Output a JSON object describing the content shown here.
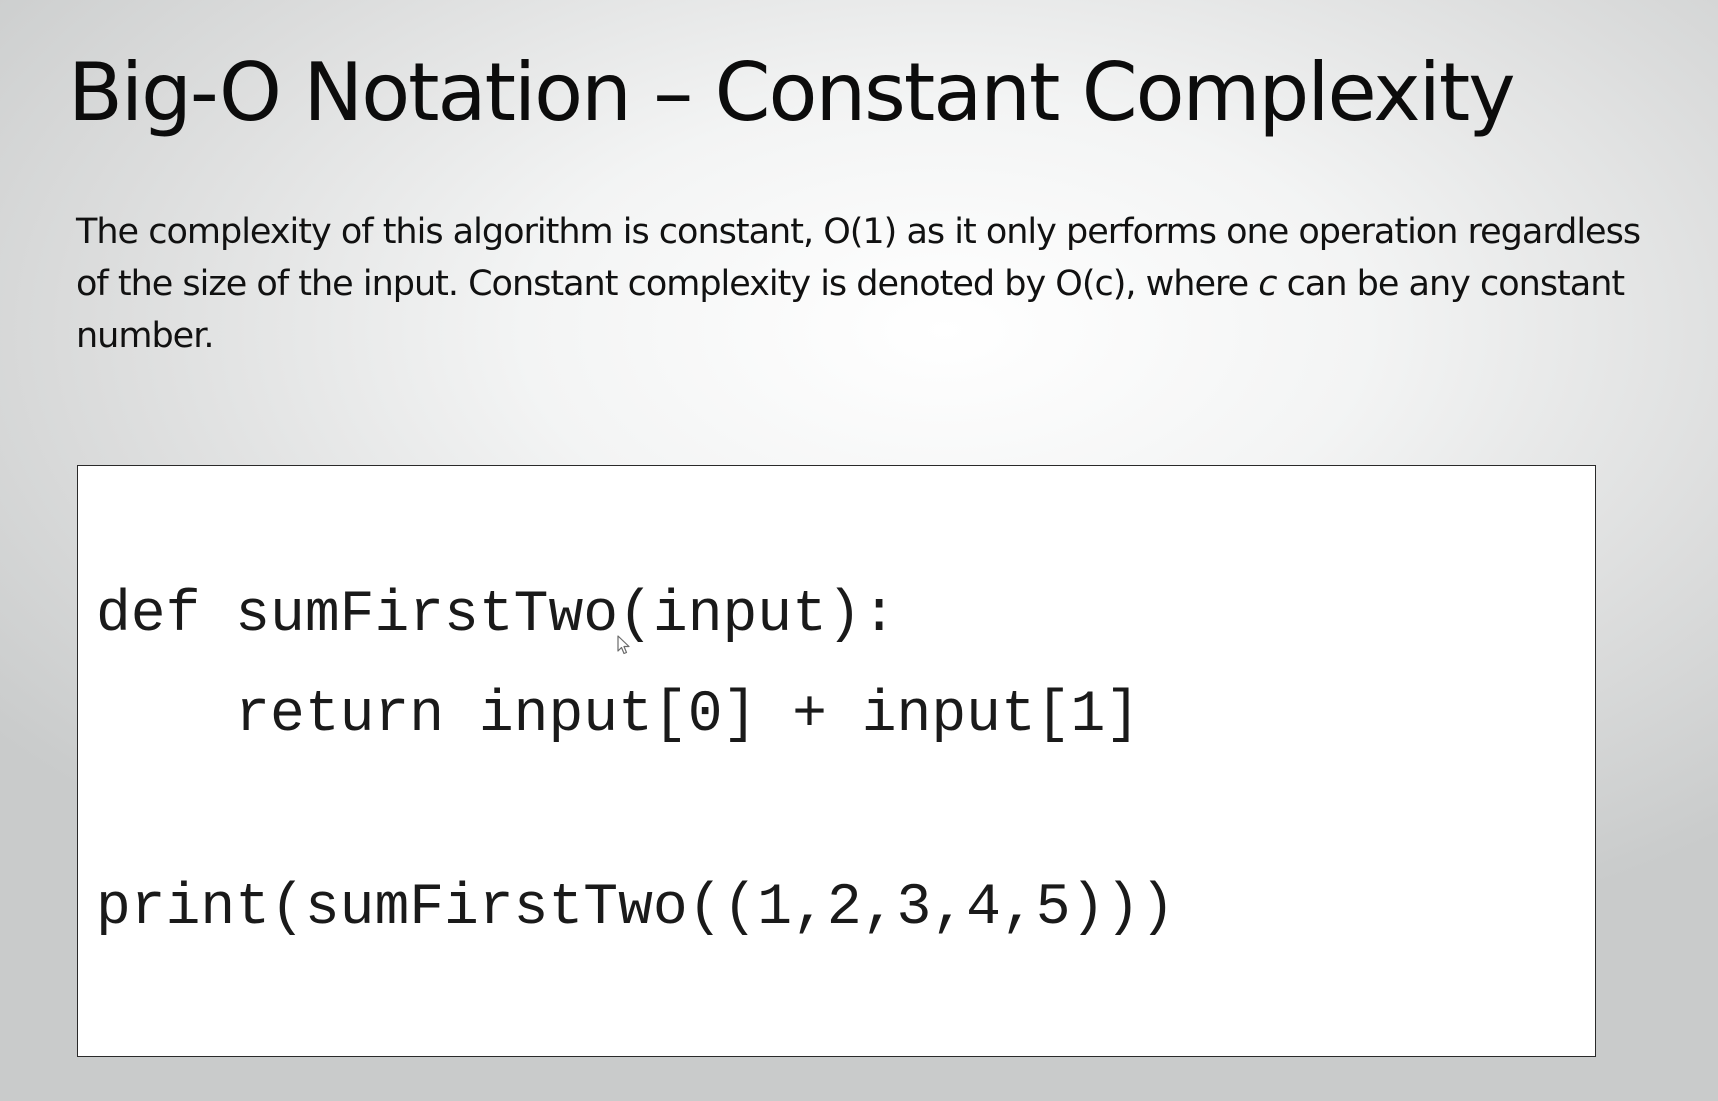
{
  "slide": {
    "title": "Big-O Notation – Constant Complexity",
    "body": {
      "part1": "The complexity of this algorithm is constant, O(1) as  it only performs one operation regardless of the size of the input.   Constant complexity is denoted by O(c), where ",
      "variable": "c",
      "part2": " can be any constant number."
    },
    "code": {
      "lines": [
        "def sumFirstTwo(input):",
        "    return input[0] + input[1]",
        "print(sumFirstTwo((1,2,3,4,5)))"
      ]
    }
  },
  "colors": {
    "text": "#111111",
    "code_background": "#ffffff",
    "code_border": "#2a2a2a"
  },
  "icons": {
    "cursor": "mouse-pointer-icon"
  }
}
